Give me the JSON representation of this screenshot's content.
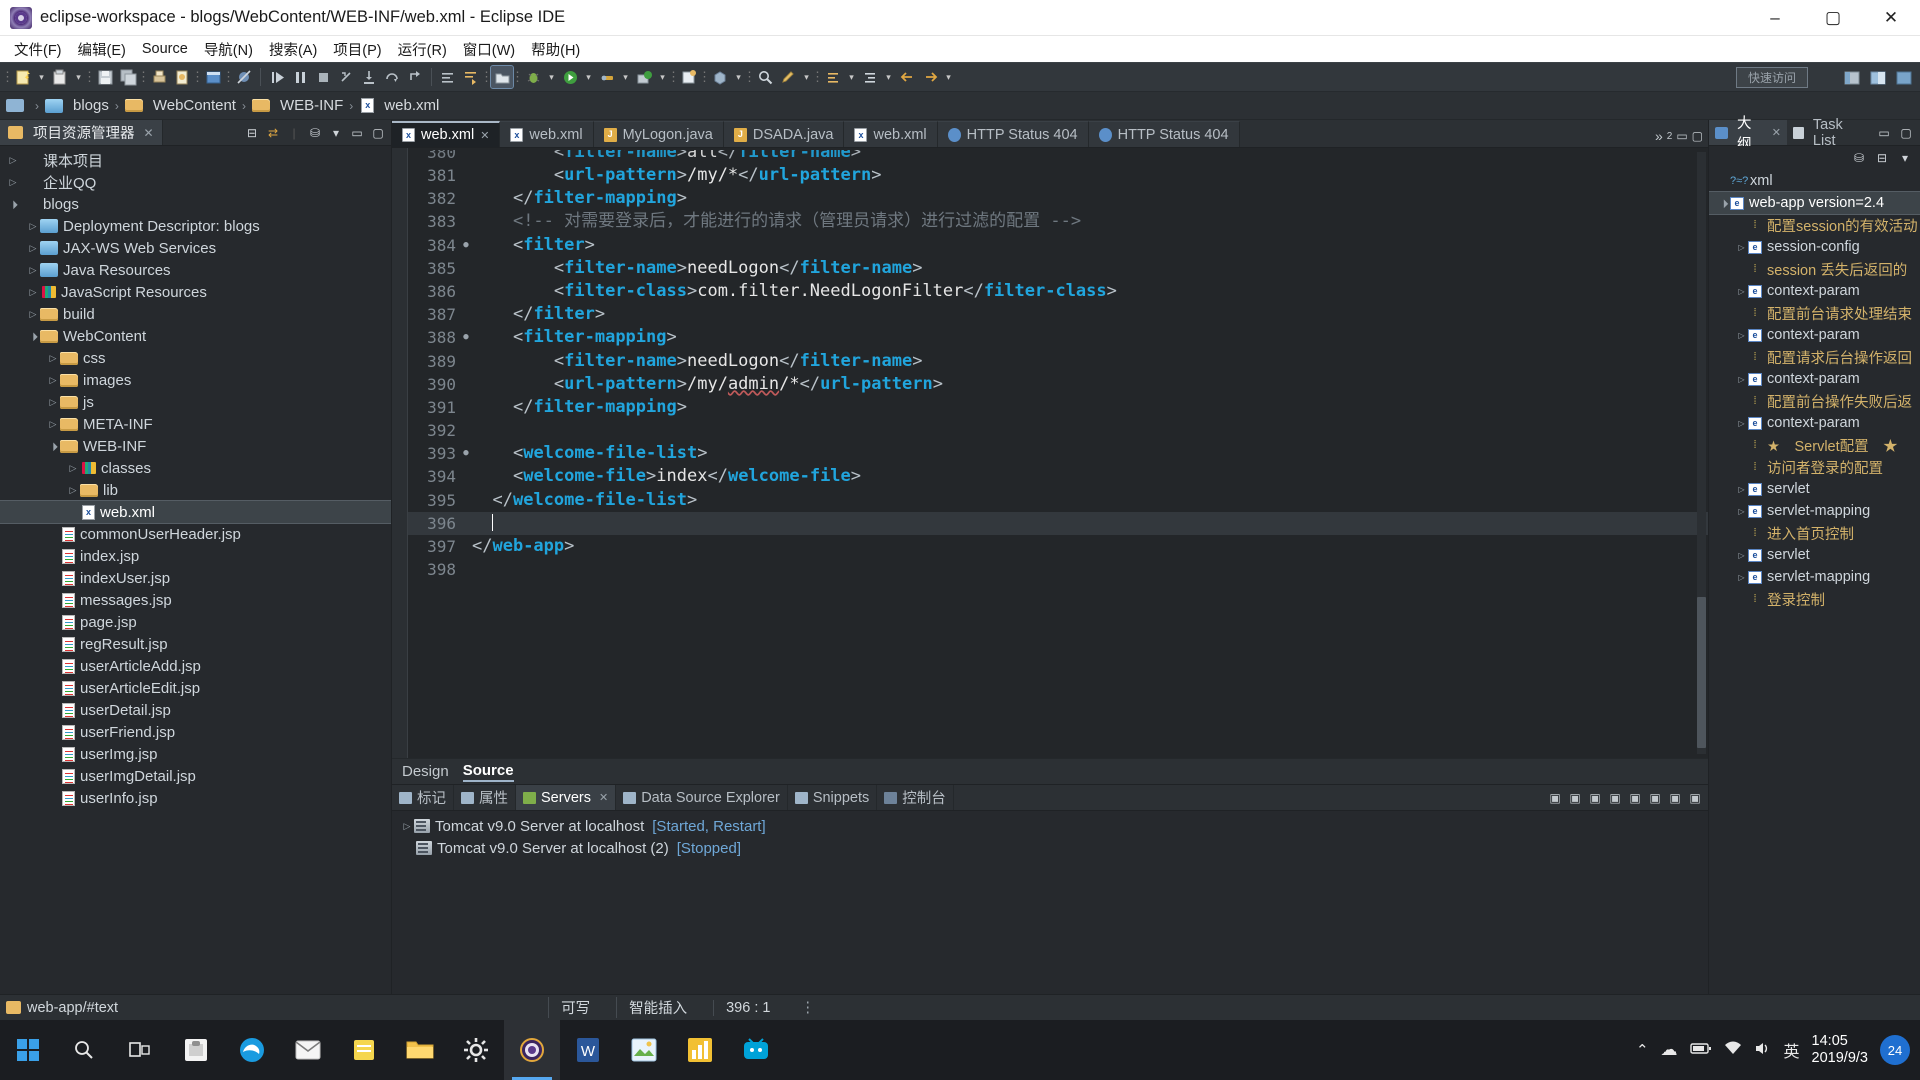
{
  "window": {
    "title": "eclipse-workspace - blogs/WebContent/WEB-INF/web.xml - Eclipse IDE",
    "minimize": "–",
    "maximize": "▢",
    "close": "✕"
  },
  "menubar": {
    "items": [
      {
        "label": "文件(F)"
      },
      {
        "label": "编辑(E)"
      },
      {
        "label": "Source"
      },
      {
        "label": "导航(N)"
      },
      {
        "label": "搜索(A)"
      },
      {
        "label": "项目(P)"
      },
      {
        "label": "运行(R)"
      },
      {
        "label": "窗口(W)"
      },
      {
        "label": "帮助(H)"
      }
    ]
  },
  "toolbar": {
    "quick_access": "快速访问"
  },
  "breadcrumb": {
    "items": [
      {
        "label": "blogs",
        "icon": "project-icon"
      },
      {
        "label": "WebContent",
        "icon": "folder-icon"
      },
      {
        "label": "WEB-INF",
        "icon": "folder-icon"
      },
      {
        "label": "web.xml",
        "icon": "xml-file-icon"
      }
    ]
  },
  "project_explorer": {
    "tab_label": "项目资源管理器",
    "tree": [
      {
        "label": "课本项目",
        "depth": 0,
        "arrow": "closed",
        "icon": "project"
      },
      {
        "label": "企业QQ",
        "depth": 0,
        "arrow": "closed",
        "icon": "project"
      },
      {
        "label": "blogs",
        "depth": 0,
        "arrow": "open",
        "icon": "project"
      },
      {
        "label": "Deployment Descriptor: blogs",
        "depth": 1,
        "arrow": "closed",
        "icon": "proj"
      },
      {
        "label": "JAX-WS Web Services",
        "depth": 1,
        "arrow": "closed",
        "icon": "proj"
      },
      {
        "label": "Java Resources",
        "depth": 1,
        "arrow": "closed",
        "icon": "proj"
      },
      {
        "label": "JavaScript Resources",
        "depth": 1,
        "arrow": "closed",
        "icon": "lib"
      },
      {
        "label": "build",
        "depth": 1,
        "arrow": "closed",
        "icon": "folder"
      },
      {
        "label": "WebContent",
        "depth": 1,
        "arrow": "open",
        "icon": "folder"
      },
      {
        "label": "css",
        "depth": 2,
        "arrow": "closed",
        "icon": "folder"
      },
      {
        "label": "images",
        "depth": 2,
        "arrow": "closed",
        "icon": "folder"
      },
      {
        "label": "js",
        "depth": 2,
        "arrow": "closed",
        "icon": "folder"
      },
      {
        "label": "META-INF",
        "depth": 2,
        "arrow": "closed",
        "icon": "folder"
      },
      {
        "label": "WEB-INF",
        "depth": 2,
        "arrow": "open",
        "icon": "folder"
      },
      {
        "label": "classes",
        "depth": 3,
        "arrow": "closed",
        "icon": "lib"
      },
      {
        "label": "lib",
        "depth": 3,
        "arrow": "closed",
        "icon": "folder"
      },
      {
        "label": "web.xml",
        "depth": 3,
        "arrow": "none",
        "icon": "xml",
        "selected": true
      },
      {
        "label": "commonUserHeader.jsp",
        "depth": 2,
        "arrow": "none",
        "icon": "file"
      },
      {
        "label": "index.jsp",
        "depth": 2,
        "arrow": "none",
        "icon": "file"
      },
      {
        "label": "indexUser.jsp",
        "depth": 2,
        "arrow": "none",
        "icon": "file"
      },
      {
        "label": "messages.jsp",
        "depth": 2,
        "arrow": "none",
        "icon": "file"
      },
      {
        "label": "page.jsp",
        "depth": 2,
        "arrow": "none",
        "icon": "file"
      },
      {
        "label": "regResult.jsp",
        "depth": 2,
        "arrow": "none",
        "icon": "file"
      },
      {
        "label": "userArticleAdd.jsp",
        "depth": 2,
        "arrow": "none",
        "icon": "file"
      },
      {
        "label": "userArticleEdit.jsp",
        "depth": 2,
        "arrow": "none",
        "icon": "file"
      },
      {
        "label": "userDetail.jsp",
        "depth": 2,
        "arrow": "none",
        "icon": "file"
      },
      {
        "label": "userFriend.jsp",
        "depth": 2,
        "arrow": "none",
        "icon": "file"
      },
      {
        "label": "userImg.jsp",
        "depth": 2,
        "arrow": "none",
        "icon": "file"
      },
      {
        "label": "userImgDetail.jsp",
        "depth": 2,
        "arrow": "none",
        "icon": "file"
      },
      {
        "label": "userInfo.jsp",
        "depth": 2,
        "arrow": "none",
        "icon": "file"
      }
    ]
  },
  "editor": {
    "tabs": [
      {
        "label": "web.xml",
        "icon": "xml-file-icon",
        "active": true,
        "closable": true
      },
      {
        "label": "web.xml",
        "icon": "xml-file-icon",
        "active": false
      },
      {
        "label": "MyLogon.java",
        "icon": "java-file-icon",
        "active": false
      },
      {
        "label": "DSADA.java",
        "icon": "java-file-icon",
        "active": false
      },
      {
        "label": "web.xml",
        "icon": "xml-file-icon",
        "active": false
      },
      {
        "label": "HTTP Status 404",
        "icon": "browser-icon",
        "active": false
      },
      {
        "label": "HTTP Status 404",
        "icon": "browser-icon",
        "active": false
      }
    ],
    "overflow_label": "»",
    "overflow_count": "2",
    "lines": [
      {
        "num": "380",
        "fold": "",
        "indent": 8,
        "partial": true,
        "segments": [
          {
            "t": "tag",
            "v": "<filter-name>"
          },
          {
            "t": "txt",
            "v": "all"
          },
          {
            "t": "tag",
            "v": "</filter-name>"
          }
        ]
      },
      {
        "num": "381",
        "fold": "",
        "indent": 8,
        "segments": [
          {
            "t": "tag",
            "v": "<url-pattern>"
          },
          {
            "t": "txt",
            "v": "/my/*"
          },
          {
            "t": "tag",
            "v": "</url-pattern>"
          }
        ]
      },
      {
        "num": "382",
        "fold": "",
        "indent": 4,
        "segments": [
          {
            "t": "tag",
            "v": "</filter-mapping>"
          }
        ]
      },
      {
        "num": "383",
        "fold": "",
        "indent": 4,
        "segments": [
          {
            "t": "cmt",
            "v": "<!-- 对需要登录后，才能进行的请求（管理员请求）进行过滤的配置 -->"
          }
        ]
      },
      {
        "num": "384",
        "fold": "●",
        "indent": 4,
        "segments": [
          {
            "t": "tag",
            "v": "<filter>"
          }
        ]
      },
      {
        "num": "385",
        "fold": "",
        "indent": 8,
        "segments": [
          {
            "t": "tag",
            "v": "<filter-name>"
          },
          {
            "t": "txt",
            "v": "needLogon"
          },
          {
            "t": "tag",
            "v": "</filter-name>"
          }
        ]
      },
      {
        "num": "386",
        "fold": "",
        "indent": 8,
        "segments": [
          {
            "t": "tag",
            "v": "<filter-class>"
          },
          {
            "t": "txt",
            "v": "com.filter.NeedLogonFilter"
          },
          {
            "t": "tag",
            "v": "</filter-class>"
          }
        ]
      },
      {
        "num": "387",
        "fold": "",
        "indent": 4,
        "segments": [
          {
            "t": "tag",
            "v": "</filter>"
          }
        ]
      },
      {
        "num": "388",
        "fold": "●",
        "indent": 4,
        "segments": [
          {
            "t": "tag",
            "v": "<filter-mapping>"
          }
        ]
      },
      {
        "num": "389",
        "fold": "",
        "indent": 8,
        "segments": [
          {
            "t": "tag",
            "v": "<filter-name>"
          },
          {
            "t": "txt",
            "v": "needLogon"
          },
          {
            "t": "tag",
            "v": "</filter-name>"
          }
        ]
      },
      {
        "num": "390",
        "fold": "",
        "indent": 8,
        "segments": [
          {
            "t": "tag",
            "v": "<url-pattern>"
          },
          {
            "t": "txt",
            "v": "/my/"
          },
          {
            "t": "squig",
            "v": "admin"
          },
          {
            "t": "txt",
            "v": "/*"
          },
          {
            "t": "tag",
            "v": "</url-pattern>"
          }
        ]
      },
      {
        "num": "391",
        "fold": "",
        "indent": 4,
        "segments": [
          {
            "t": "tag",
            "v": "</filter-mapping>"
          }
        ]
      },
      {
        "num": "392",
        "fold": "",
        "indent": 0,
        "segments": []
      },
      {
        "num": "393",
        "fold": "●",
        "indent": 4,
        "segments": [
          {
            "t": "tag",
            "v": "<welcome-file-list>"
          }
        ]
      },
      {
        "num": "394",
        "fold": "",
        "indent": 4,
        "segments": [
          {
            "t": "tag",
            "v": "<welcome-file>"
          },
          {
            "t": "txt",
            "v": "index"
          },
          {
            "t": "tag",
            "v": "</welcome-file>"
          }
        ]
      },
      {
        "num": "395",
        "fold": "",
        "indent": 2,
        "segments": [
          {
            "t": "tag",
            "v": "</welcome-file-list>"
          }
        ]
      },
      {
        "num": "396",
        "fold": "",
        "indent": 2,
        "current": true,
        "cursor": true,
        "segments": []
      },
      {
        "num": "397",
        "fold": "",
        "indent": 0,
        "segments": [
          {
            "t": "tag",
            "v": "</web-app>"
          }
        ]
      },
      {
        "num": "398",
        "fold": "",
        "indent": 0,
        "segments": []
      }
    ],
    "design_source": {
      "design_label": "Design",
      "source_label": "Source"
    }
  },
  "bottom_panel": {
    "tabs": [
      {
        "label": "标记",
        "icon": "marker-icon",
        "active": false
      },
      {
        "label": "属性",
        "icon": "properties-icon",
        "active": false
      },
      {
        "label": "Servers",
        "icon": "servers-icon",
        "active": true,
        "closable": true
      },
      {
        "label": "Data Source Explorer",
        "icon": "datasource-icon",
        "active": false
      },
      {
        "label": "Snippets",
        "icon": "snippets-icon",
        "active": false
      },
      {
        "label": "控制台",
        "icon": "console-icon",
        "active": false
      }
    ],
    "servers": [
      {
        "name": "Tomcat v9.0 Server at localhost",
        "status": "[Started, Restart]",
        "arrow": "closed"
      },
      {
        "name": "Tomcat v9.0 Server at localhost (2)",
        "status": "[Stopped]",
        "arrow": "none"
      }
    ]
  },
  "outline": {
    "tabs": [
      {
        "label": "大纲",
        "active": true,
        "closable": true
      },
      {
        "label": "Task List",
        "active": false
      }
    ],
    "items": [
      {
        "label": "xml",
        "depth": 0,
        "arrow": "none",
        "kind": "decl"
      },
      {
        "label": "web-app version=2.4",
        "depth": 0,
        "arrow": "open",
        "kind": "element",
        "selected": true
      },
      {
        "label": "配置session的有效活动",
        "depth": 1,
        "arrow": "none",
        "kind": "comment"
      },
      {
        "label": "session-config",
        "depth": 1,
        "arrow": "closed",
        "kind": "element"
      },
      {
        "label": "session 丢失后返回的",
        "depth": 1,
        "arrow": "none",
        "kind": "comment"
      },
      {
        "label": "context-param",
        "depth": 1,
        "arrow": "closed",
        "kind": "element"
      },
      {
        "label": "配置前台请求处理结束",
        "depth": 1,
        "arrow": "none",
        "kind": "comment"
      },
      {
        "label": "context-param",
        "depth": 1,
        "arrow": "closed",
        "kind": "element"
      },
      {
        "label": "配置请求后台操作返回",
        "depth": 1,
        "arrow": "none",
        "kind": "comment"
      },
      {
        "label": "context-param",
        "depth": 1,
        "arrow": "closed",
        "kind": "element"
      },
      {
        "label": "配置前台操作失败后返",
        "depth": 1,
        "arrow": "none",
        "kind": "comment"
      },
      {
        "label": "context-param",
        "depth": 1,
        "arrow": "closed",
        "kind": "element"
      },
      {
        "label": "★　Servlet配置　★",
        "depth": 1,
        "arrow": "none",
        "kind": "comment"
      },
      {
        "label": "访问者登录的配置",
        "depth": 1,
        "arrow": "none",
        "kind": "comment"
      },
      {
        "label": "servlet",
        "depth": 1,
        "arrow": "closed",
        "kind": "element"
      },
      {
        "label": "servlet-mapping",
        "depth": 1,
        "arrow": "closed",
        "kind": "element"
      },
      {
        "label": "进入首页控制",
        "depth": 1,
        "arrow": "none",
        "kind": "comment"
      },
      {
        "label": "servlet",
        "depth": 1,
        "arrow": "closed",
        "kind": "element"
      },
      {
        "label": "servlet-mapping",
        "depth": 1,
        "arrow": "closed",
        "kind": "element"
      },
      {
        "label": "登录控制",
        "depth": 1,
        "arrow": "none",
        "kind": "comment"
      }
    ]
  },
  "statusbar": {
    "path": "web-app/#text",
    "writable": "可写",
    "insert_mode": "智能插入",
    "position": "396 : 1"
  },
  "taskbar": {
    "items": [
      {
        "name": "start-button",
        "icon": "windows-logo"
      },
      {
        "name": "search-button",
        "icon": "search-icon"
      },
      {
        "name": "task-view-button",
        "icon": "taskview-icon"
      },
      {
        "name": "microsoft-store",
        "icon": "store-icon"
      },
      {
        "name": "edge-browser",
        "icon": "edge-icon"
      },
      {
        "name": "mail-app",
        "icon": "mail-icon"
      },
      {
        "name": "sticky-notes",
        "icon": "notes-icon"
      },
      {
        "name": "file-explorer",
        "icon": "folder-icon"
      },
      {
        "name": "settings-app",
        "icon": "gear-icon"
      },
      {
        "name": "eclipse-ide",
        "icon": "eclipse-icon",
        "active": true
      },
      {
        "name": "word-app",
        "icon": "word-icon"
      },
      {
        "name": "screenshot-tool",
        "icon": "capture-icon"
      },
      {
        "name": "chart-app",
        "icon": "chart-icon"
      },
      {
        "name": "bilibili-app",
        "icon": "bilibili-icon"
      }
    ],
    "tray": {
      "chevron": "⌃",
      "cloud": "☁",
      "battery": "▭",
      "wifi": "◗",
      "volume": "🔊",
      "ime": "英",
      "time": "14:05",
      "date": "2019/9/3",
      "notification_count": "24"
    }
  }
}
